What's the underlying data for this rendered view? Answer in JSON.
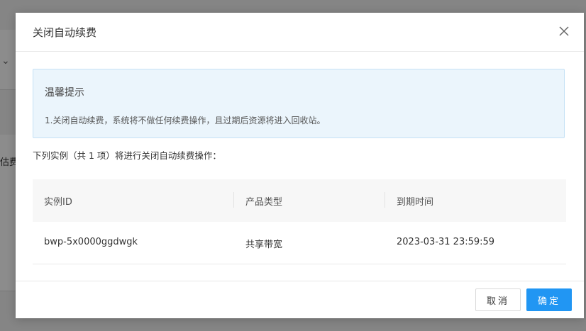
{
  "background": {
    "partial_text": "估费"
  },
  "dialog": {
    "title": "关闭自动续费",
    "close_icon": "close-icon"
  },
  "alert": {
    "title": "温馨提示",
    "message": "1.关闭自动续费，系统将不做任何续费操作，且过期后资源将进入回收站。"
  },
  "intro_text": "下列实例（共 1 项）将进行关闭自动续费操作：",
  "table": {
    "headers": [
      "实例ID",
      "产品类型",
      "到期时间"
    ],
    "rows": [
      [
        "bwp-5x0000ggdwgk",
        "共享带宽",
        "2023-03-31 23:59:59"
      ]
    ]
  },
  "footer": {
    "cancel_label": "取消",
    "ok_label": "确定"
  },
  "colors": {
    "primary": "#2196f3",
    "alert_bg": "#ebf5fc",
    "mask": "rgba(0,0,0,0.45)"
  }
}
